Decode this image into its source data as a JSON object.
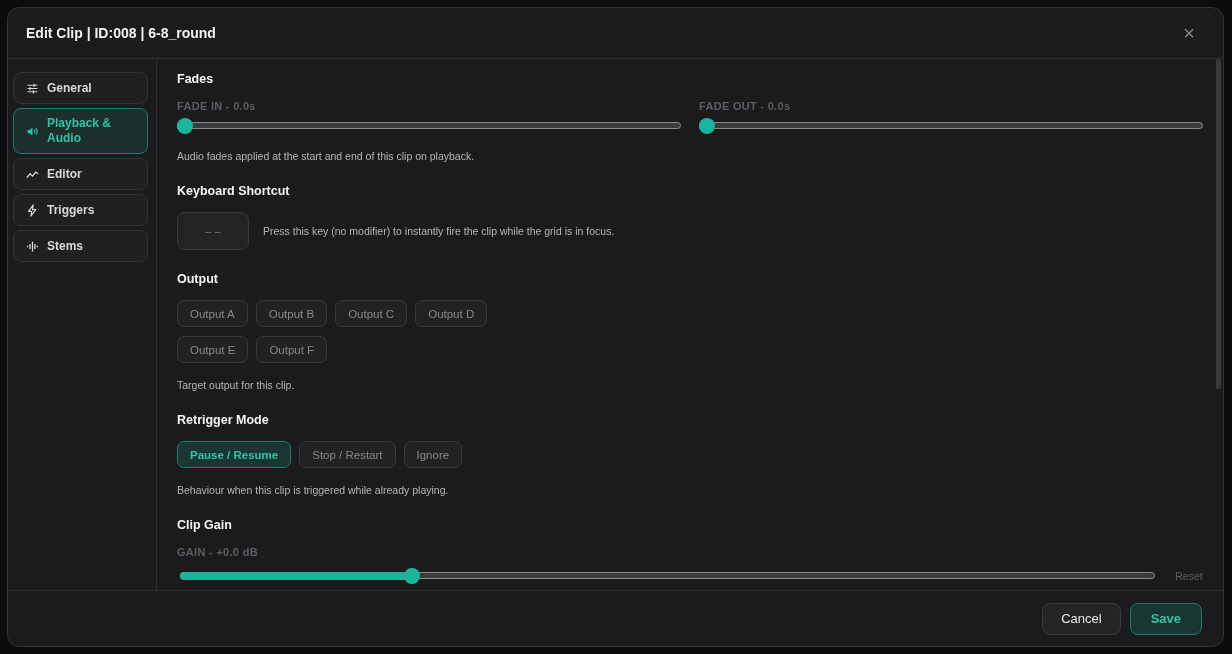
{
  "dialog": {
    "title": "Edit Clip | ID:008 | 6-8_round",
    "close": "×"
  },
  "sidebar": {
    "items": [
      {
        "label": "General",
        "selected": false
      },
      {
        "label": "Playback & Audio",
        "selected": true
      },
      {
        "label": "Editor",
        "selected": false
      },
      {
        "label": "Triggers",
        "selected": false
      },
      {
        "label": "Stems",
        "selected": false
      }
    ]
  },
  "sections": [
    {
      "kind": "fades",
      "title": "Fades",
      "sliders": [
        {
          "label": "FADE IN - 0.0s",
          "level": 0
        },
        {
          "label": "FADE OUT - 0.0s",
          "level": 0
        }
      ],
      "hint": "Audio fades applied at the start and end of this clip on playback."
    },
    {
      "kind": "shortcut",
      "title": "Keyboard Shortcut",
      "key": "– –",
      "hint": "Press this key (no modifier) to instantly fire the clip while the grid is in focus."
    },
    {
      "kind": "options",
      "title": "Output",
      "rows": [
        [
          {
            "label": "Output A",
            "selected": false
          },
          {
            "label": "Output B",
            "selected": false
          },
          {
            "label": "Output C",
            "selected": false
          },
          {
            "label": "Output D",
            "selected": false
          }
        ],
        [
          {
            "label": "Output E",
            "selected": false
          },
          {
            "label": "Output F",
            "selected": false
          }
        ]
      ],
      "hint": "Target output for this clip."
    },
    {
      "kind": "options",
      "title": "Retrigger Mode",
      "rows": [
        [
          {
            "label": "Pause / Resume",
            "selected": true
          },
          {
            "label": "Stop / Restart",
            "selected": false
          },
          {
            "label": "Ignore",
            "selected": false
          }
        ]
      ],
      "hint": "Behaviour when this clip is triggered while already playing."
    },
    {
      "kind": "gain",
      "title": "Clip Gain",
      "label": "GAIN - +0.0 dB",
      "level": 0.234,
      "reset": "Reset"
    }
  ],
  "footer": {
    "buttons": [
      {
        "label": "Cancel",
        "kind": "secondary"
      },
      {
        "label": "Save",
        "kind": "primary"
      }
    ]
  }
}
